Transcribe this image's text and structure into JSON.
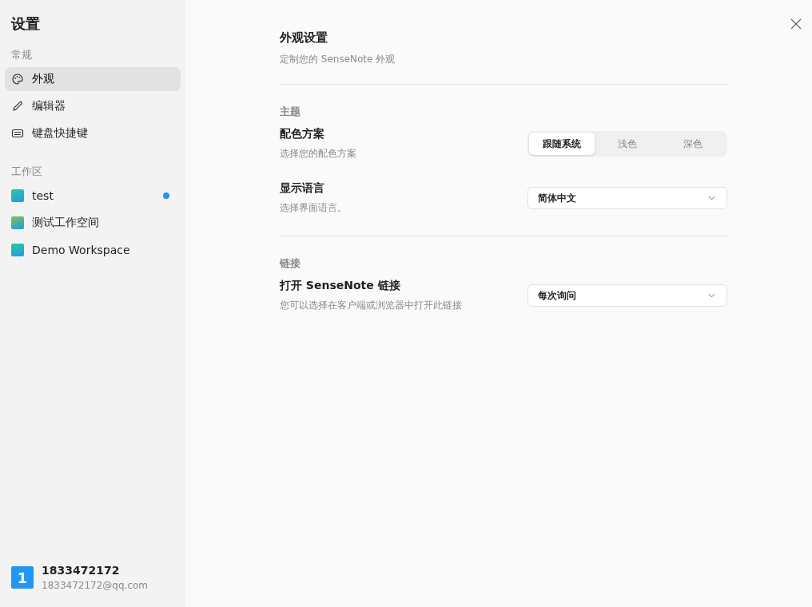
{
  "sidebar": {
    "title": "设置",
    "general": {
      "heading": "常规",
      "items": [
        {
          "label": "外观",
          "selected": true
        },
        {
          "label": "编辑器",
          "selected": false
        },
        {
          "label": "键盘快捷键",
          "selected": false
        }
      ]
    },
    "workspaces": {
      "heading": "工作区",
      "items": [
        {
          "label": "test",
          "unread": true
        },
        {
          "label": "测试工作空间",
          "unread": false
        },
        {
          "label": "Demo Workspace",
          "unread": false
        }
      ]
    },
    "account": {
      "avatar": "1",
      "name": "1833472172",
      "email": "1833472172@qq.com"
    }
  },
  "main": {
    "title": "外观设置",
    "subtitle": "定制您的 SenseNote 外观",
    "sections": [
      {
        "heading": "主题",
        "rows": [
          {
            "kind": "segmented",
            "label": "配色方案",
            "description": "选择您的配色方案",
            "options": [
              {
                "label": "跟随系统",
                "selected": true
              },
              {
                "label": "浅色",
                "selected": false
              },
              {
                "label": "深色",
                "selected": false
              }
            ]
          },
          {
            "kind": "dropdown",
            "label": "显示语言",
            "description": "选择界面语言。",
            "value": "简体中文"
          }
        ]
      },
      {
        "heading": "链接",
        "rows": [
          {
            "kind": "dropdown",
            "label": "打开 SenseNote 链接",
            "description": "您可以选择在客户端或浏览器中打开此链接",
            "value": "每次询问"
          }
        ]
      }
    ]
  }
}
